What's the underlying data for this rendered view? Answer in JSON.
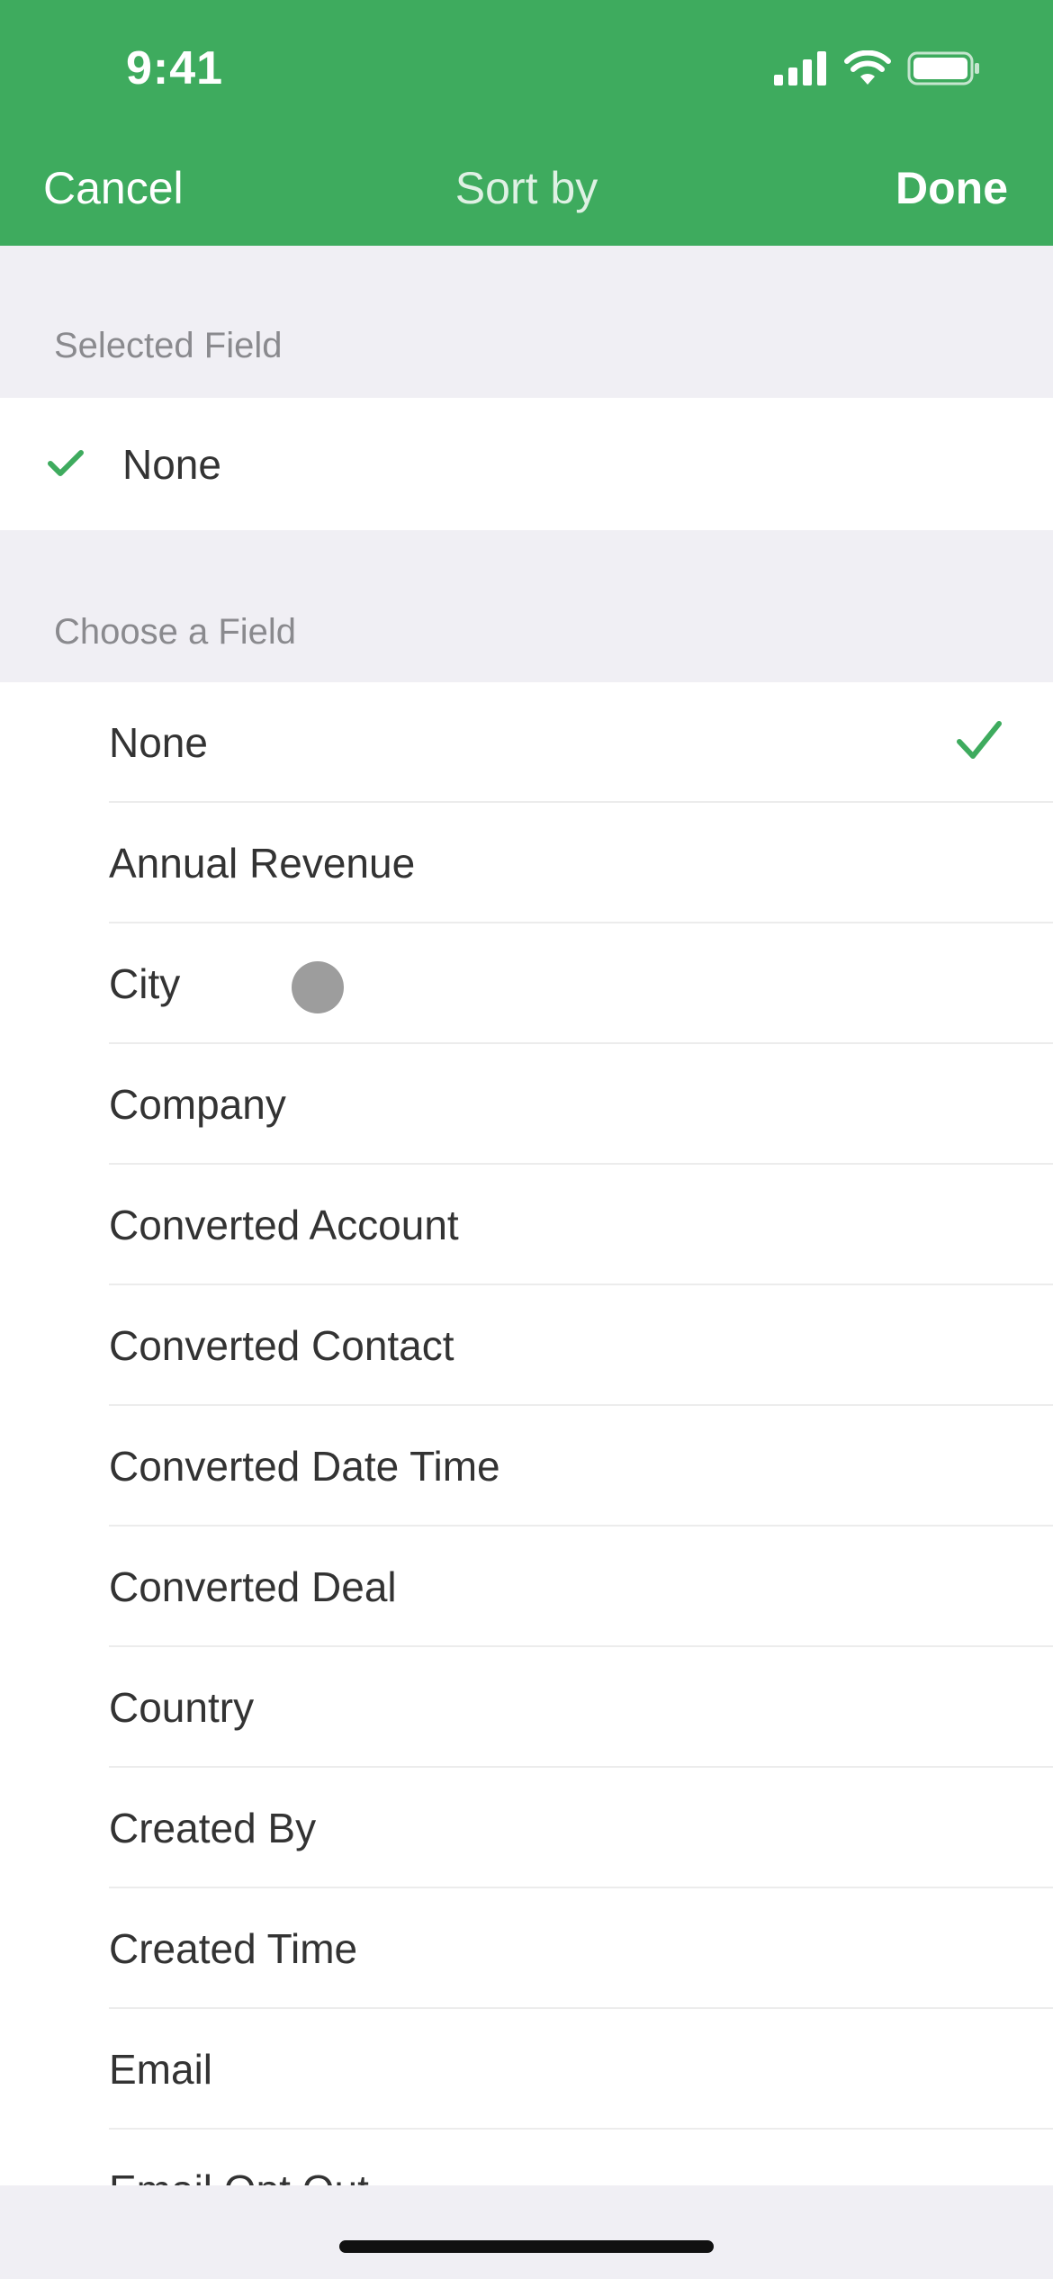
{
  "status_bar": {
    "time": "9:41",
    "icons": [
      "cellular-signal-icon",
      "wifi-icon",
      "battery-icon"
    ]
  },
  "nav": {
    "cancel_label": "Cancel",
    "title": "Sort by",
    "done_label": "Done"
  },
  "selected_section": {
    "header": "Selected Field",
    "value": "None"
  },
  "choose_section": {
    "header": "Choose a Field",
    "items": [
      {
        "label": "None",
        "checked": true
      },
      {
        "label": "Annual Revenue",
        "checked": false
      },
      {
        "label": "City",
        "checked": false
      },
      {
        "label": "Company",
        "checked": false
      },
      {
        "label": "Converted Account",
        "checked": false
      },
      {
        "label": "Converted Contact",
        "checked": false
      },
      {
        "label": "Converted Date Time",
        "checked": false
      },
      {
        "label": "Converted Deal",
        "checked": false
      },
      {
        "label": "Country",
        "checked": false
      },
      {
        "label": "Created By",
        "checked": false
      },
      {
        "label": "Created Time",
        "checked": false
      },
      {
        "label": "Email",
        "checked": false
      },
      {
        "label": "Email Opt Out",
        "checked": false
      }
    ]
  },
  "colors": {
    "header_green": "#3eab5e",
    "check_green": "#3eab5e",
    "background_gray": "#f0eff4"
  }
}
